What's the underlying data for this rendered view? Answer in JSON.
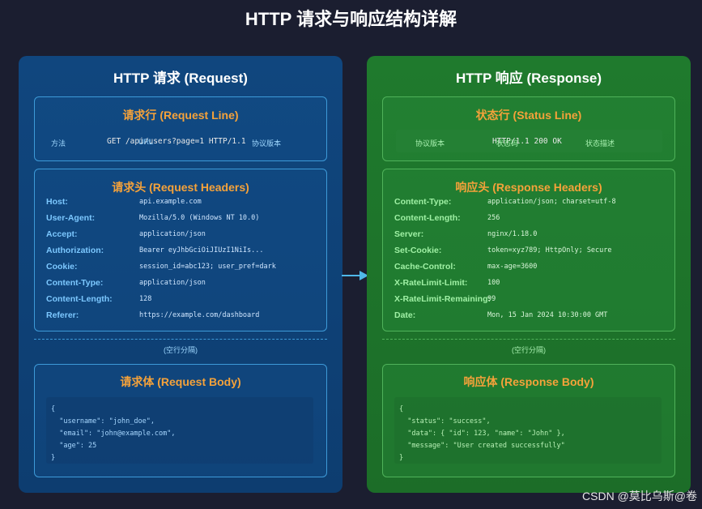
{
  "title": "HTTP 请求与响应结构详解",
  "request": {
    "title": "HTTP 请求 (Request)",
    "request_line": {
      "title": "请求行 (Request Line)",
      "method_label": "方法",
      "url_label": "URL",
      "value": "GET /api/users?page=1 HTTP/1.1",
      "version_label": "协议版本"
    },
    "headers": {
      "title": "请求头 (Request Headers)",
      "rows": [
        {
          "key": "Host:",
          "value": "api.example.com"
        },
        {
          "key": "User-Agent:",
          "value": "Mozilla/5.0 (Windows NT 10.0)"
        },
        {
          "key": "Accept:",
          "value": "application/json"
        },
        {
          "key": "Authorization:",
          "value": "Bearer eyJhbGciOiJIUzI1NiIs..."
        },
        {
          "key": "Cookie:",
          "value": "session_id=abc123; user_pref=dark"
        },
        {
          "key": "Content-Type:",
          "value": "application/json"
        },
        {
          "key": "Content-Length:",
          "value": "128"
        },
        {
          "key": "Referer:",
          "value": "https://example.com/dashboard"
        }
      ]
    },
    "separator": "(空行分隔)",
    "body": {
      "title": "请求体 (Request Body)",
      "lines": [
        "{",
        "  \"username\": \"john_doe\",",
        "  \"email\": \"john@example.com\",",
        "  \"age\": 25",
        "}"
      ]
    }
  },
  "response": {
    "title": "HTTP 响应 (Response)",
    "status_line": {
      "title": "状态行 (Status Line)",
      "version_label": "协议版本",
      "code_label": "状态码",
      "value": "HTTP/1.1 200 OK",
      "desc_label": "状态描述"
    },
    "headers": {
      "title": "响应头 (Response Headers)",
      "rows": [
        {
          "key": "Content-Type:",
          "value": "application/json; charset=utf-8"
        },
        {
          "key": "Content-Length:",
          "value": "256"
        },
        {
          "key": "Server:",
          "value": "nginx/1.18.0"
        },
        {
          "key": "Set-Cookie:",
          "value": "token=xyz789; HttpOnly; Secure"
        },
        {
          "key": "Cache-Control:",
          "value": "max-age=3600"
        },
        {
          "key": "X-RateLimit-Limit:",
          "value": "100"
        },
        {
          "key": "X-RateLimit-Remaining:",
          "value": "99"
        },
        {
          "key": "Date:",
          "value": "Mon, 15 Jan 2024 10:30:00 GMT"
        }
      ]
    },
    "separator": "(空行分隔)",
    "body": {
      "title": "响应体 (Response Body)",
      "lines": [
        "{",
        "  \"status\": \"success\",",
        "  \"data\": { \"id\": 123, \"name\": \"John\" },",
        "  \"message\": \"User created successfully\"",
        "}"
      ]
    }
  },
  "watermark": "CSDN @莫比乌斯@卷",
  "colors": {
    "background": "#1b1e30",
    "request_panel": "#10467e",
    "response_panel": "#1f7a2d",
    "section_title": "#f5a23a",
    "arrow": "#4fb7e8"
  }
}
